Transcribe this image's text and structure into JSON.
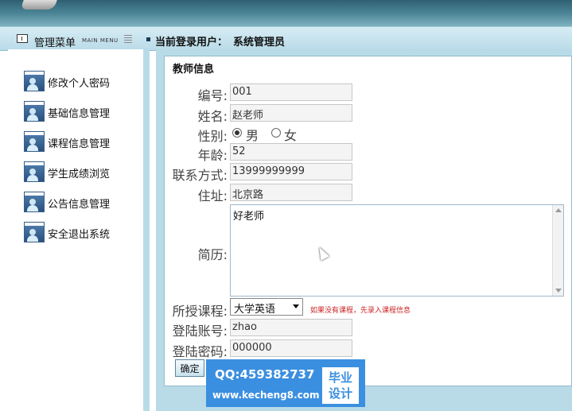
{
  "header": {
    "menu_title": "管理菜单",
    "menu_title_en": "MAIN MENU",
    "user_label": "当前登录用户：",
    "user_name": "系统管理员"
  },
  "sidebar": {
    "items": [
      {
        "label": "修改个人密码"
      },
      {
        "label": "基础信息管理"
      },
      {
        "label": "课程信息管理"
      },
      {
        "label": "学生成绩浏览"
      },
      {
        "label": "公告信息管理"
      },
      {
        "label": "安全退出系统"
      }
    ]
  },
  "form": {
    "title": "教师信息",
    "id_label": "编号:",
    "id_value": "001",
    "name_label": "姓名:",
    "name_value": "赵老师",
    "gender_label": "性别:",
    "gender_male": "男",
    "gender_female": "女",
    "age_label": "年龄:",
    "age_value": "52",
    "phone_label": "联系方式:",
    "phone_value": "13999999999",
    "address_label": "住址:",
    "address_value": "北京路",
    "resume_label": "简历:",
    "resume_value": "好老师",
    "course_label": "所授课程:",
    "course_value": "大学英语",
    "course_hint": "如果没有课程，先录入课程信息",
    "account_label": "登陆账号:",
    "account_value": "zhao",
    "password_label": "登陆密码:",
    "password_value": "000000",
    "submit_label": "确定"
  },
  "watermark": {
    "qq": "QQ:459382737",
    "url": "www.kecheng8.com",
    "line1": "毕业",
    "line2": "设计"
  }
}
